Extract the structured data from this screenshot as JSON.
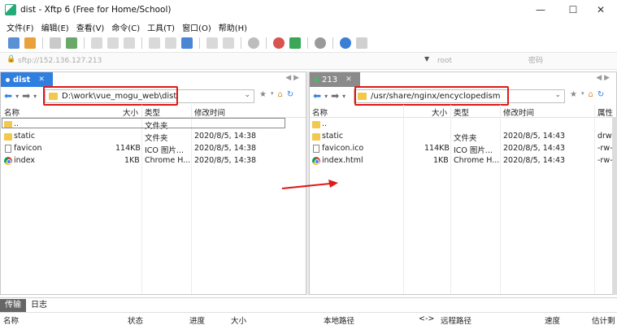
{
  "window": {
    "title": "dist - Xftp 6 (Free for Home/School)",
    "controls": {
      "minimize": "—",
      "maximize": "☐",
      "close": "✕"
    }
  },
  "menu": [
    "文件(F)",
    "编辑(E)",
    "查看(V)",
    "命令(C)",
    "工具(T)",
    "窗口(O)",
    "帮助(H)"
  ],
  "address": {
    "host_placeholder": "sftp://152.136.127.213",
    "user_placeholder": "root",
    "password_placeholder": "密码"
  },
  "left_pane": {
    "tab_label": "dist",
    "path": "D:\\work\\vue_mogu_web\\dist",
    "columns": {
      "name": "名称",
      "size": "大小",
      "type": "类型",
      "modified": "修改时间"
    },
    "rows": [
      {
        "name": "..",
        "size": "",
        "type": "文件夹",
        "modified": "",
        "icon": "folder-icon"
      },
      {
        "name": "static",
        "size": "",
        "type": "文件夹",
        "modified": "2020/8/5, 14:38",
        "icon": "folder-icon"
      },
      {
        "name": "favicon",
        "size": "114KB",
        "type": "ICO 图片...",
        "modified": "2020/8/5, 14:38",
        "icon": "file-icon"
      },
      {
        "name": "index",
        "size": "1KB",
        "type": "Chrome H...",
        "modified": "2020/8/5, 14:38",
        "icon": "chrome-icon"
      }
    ]
  },
  "right_pane": {
    "tab_label": "213",
    "path": "/usr/share/nginx/encyclopedism",
    "columns": {
      "name": "名称",
      "size": "大小",
      "type": "类型",
      "modified": "修改时间",
      "attr": "属性"
    },
    "rows": [
      {
        "name": "..",
        "size": "",
        "type": "",
        "modified": "",
        "attr": "",
        "icon": "folder-icon"
      },
      {
        "name": "static",
        "size": "",
        "type": "文件夹",
        "modified": "2020/8/5, 14:43",
        "attr": "drwxr",
        "icon": "folder-icon"
      },
      {
        "name": "favicon.ico",
        "size": "114KB",
        "type": "ICO 图片...",
        "modified": "2020/8/5, 14:43",
        "attr": "-rw-r",
        "icon": "file-icon"
      },
      {
        "name": "index.html",
        "size": "1KB",
        "type": "Chrome H...",
        "modified": "2020/8/5, 14:43",
        "attr": "-rw-r",
        "icon": "chrome-icon"
      }
    ]
  },
  "bottom": {
    "tabs": [
      "传输",
      "日志"
    ],
    "columns": {
      "name": "名称",
      "status": "状态",
      "progress": "进度",
      "size": "大小",
      "local": "本地路径",
      "dir": "<->",
      "remote": "远程路径",
      "speed": "速度",
      "eta": "估计剩"
    }
  },
  "colors": {
    "accent": "#2f7fe0",
    "highlight": "#e01818"
  }
}
